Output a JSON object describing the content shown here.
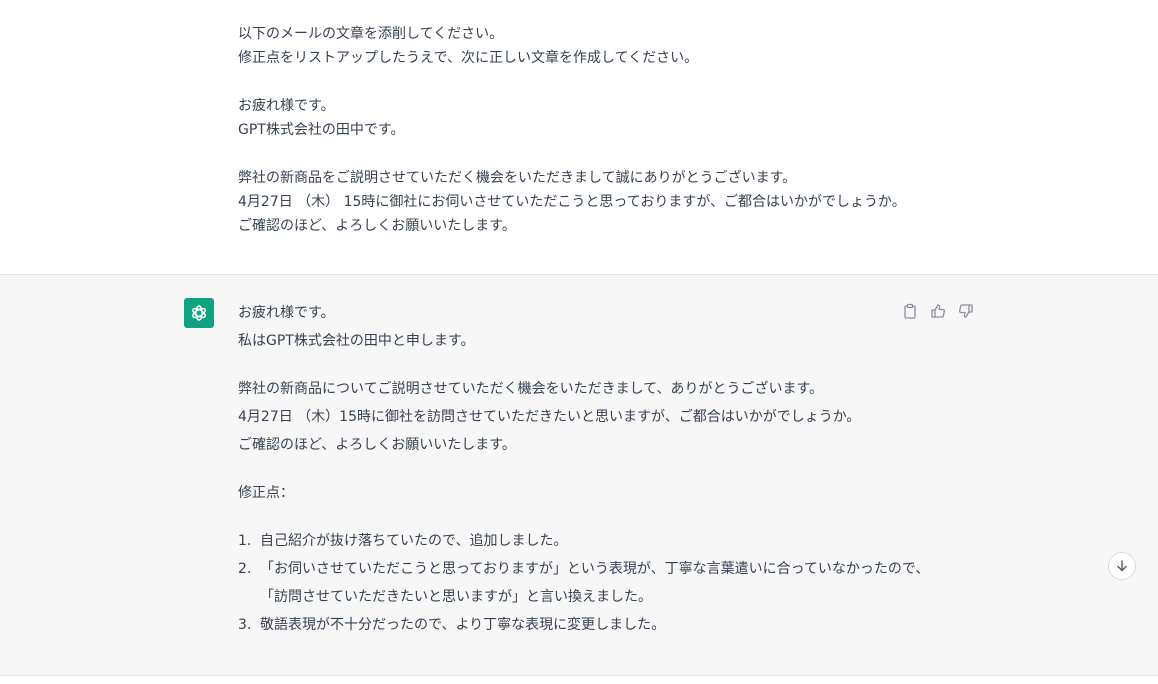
{
  "user_message": {
    "lines": [
      "以下のメールの文章を添削してください。",
      "修正点をリストアップしたうえで、次に正しい文章を作成してください。",
      "お疲れ様です。",
      "GPT株式会社の田中です。",
      "弊社の新商品をご説明させていただく機会をいただきまして誠にありがとうございます。",
      "4月27日 （木） 15時に御社にお伺いさせていただこうと思っておりますが、ご都合はいかがでしょうか。",
      "ご確認のほど、よろしくお願いいたします。"
    ]
  },
  "assistant_message": {
    "lines": [
      "お疲れ様です。",
      "私はGPT株式会社の田中と申します。",
      "弊社の新商品についてご説明させていただく機会をいただきまして、ありがとうございます。",
      "4月27日 （木）15時に御社を訪問させていただきたいと思いますが、ご都合はいかがでしょうか。",
      "ご確認のほど、よろしくお願いいたします。",
      "修正点："
    ],
    "list": [
      {
        "num": "1.",
        "text": "自己紹介が抜け落ちていたので、追加しました。"
      },
      {
        "num": "2.",
        "text": "「お伺いさせていただこうと思っておりますが」という表現が、丁寧な言葉遣いに合っていなかったので、"
      },
      {
        "num": "",
        "text": "「訪問させていただきたいと思いますが」と言い換えました。"
      },
      {
        "num": "3.",
        "text": "敬語表現が不十分だったので、より丁寧な表現に変更しました。"
      }
    ],
    "avatar_icon": "openai-logo-icon",
    "avatar_color": "#10a37f"
  },
  "actions": {
    "copy_icon": "clipboard-icon",
    "like_icon": "thumbs-up-icon",
    "dislike_icon": "thumbs-down-icon"
  },
  "scroll_icon": "arrow-down-icon"
}
